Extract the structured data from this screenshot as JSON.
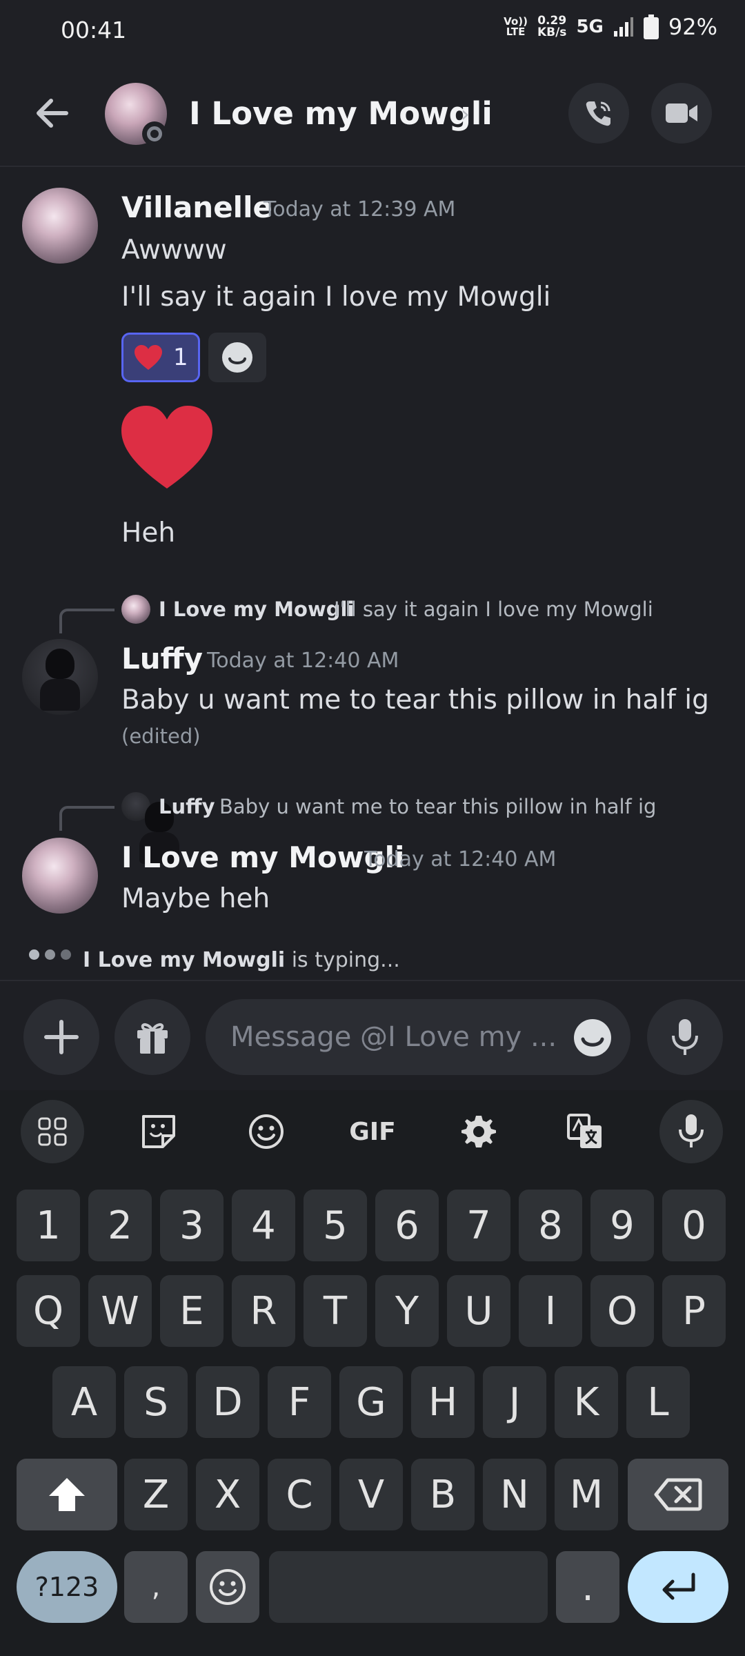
{
  "status_bar": {
    "time": "00:41",
    "volte_top": "Vo))",
    "volte_bottom": "LTE",
    "speed_value": "0.29",
    "speed_unit": "KB/s",
    "network": "5G",
    "battery": "92%"
  },
  "header": {
    "title": "I Love my Mowgli",
    "chevron": "›"
  },
  "messages": [
    {
      "author": "Villanelle",
      "time": "Today at 12:39 AM",
      "lines": [
        "Awwww",
        "I'll say it again I love my Mowgli"
      ],
      "reaction": {
        "emoji": "heart",
        "count": "1"
      },
      "extra_line": "Heh"
    },
    {
      "reply_to": {
        "name": "I Love my Mowgli",
        "text": "I'll say it again I love my Mowgli"
      },
      "author": "Luffy",
      "time": "Today at 12:40 AM",
      "text": "Baby u want me to tear this pillow in half ig",
      "edited": "(edited)"
    },
    {
      "reply_to": {
        "name": "Luffy",
        "text": "Baby u want me to tear this pillow in half ig"
      },
      "author": "I Love my Mowgli",
      "time": "Today at 12:40 AM",
      "text": "Maybe heh"
    }
  ],
  "typing": {
    "name": "I Love my Mowgli",
    "suffix": " is typing..."
  },
  "input": {
    "placeholder": "Message @I Love my ..."
  },
  "keyboard": {
    "tools": [
      "apps-grid-icon",
      "sticker-icon",
      "emoji-icon",
      "GIF",
      "settings-icon",
      "translate-icon",
      "mic-icon"
    ],
    "row_numbers": [
      "1",
      "2",
      "3",
      "4",
      "5",
      "6",
      "7",
      "8",
      "9",
      "0"
    ],
    "row1": [
      "Q",
      "W",
      "E",
      "R",
      "T",
      "Y",
      "U",
      "I",
      "O",
      "P"
    ],
    "row2": [
      "A",
      "S",
      "D",
      "F",
      "G",
      "H",
      "J",
      "K",
      "L"
    ],
    "row3": [
      "Z",
      "X",
      "C",
      "V",
      "B",
      "N",
      "M"
    ],
    "sym_label": "?123",
    "comma": ",",
    "period": "."
  }
}
